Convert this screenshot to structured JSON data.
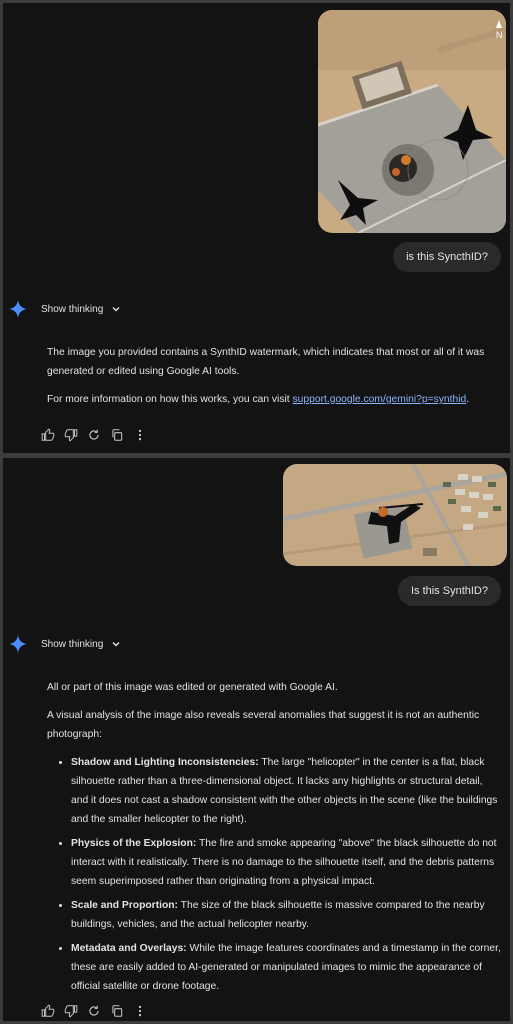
{
  "conversation1": {
    "user_message": "is this SyncthID?",
    "thinking_label": "Show thinking",
    "response": {
      "p1": "The image you provided contains a SynthID watermark, which indicates that most or all of it was generated or edited using Google AI tools.",
      "p2_prefix": "For more information on how this works, you can visit ",
      "link": "support.google.com/gemini?p=synthid",
      "p2_suffix": "."
    },
    "image_compass": "N"
  },
  "conversation2": {
    "user_message": "Is this SynthID?",
    "thinking_label": "Show thinking",
    "response": {
      "p1": "All or part of this image was edited or generated with Google AI.",
      "p2": "A visual analysis of the image also reveals several anomalies that suggest it is not an authentic photograph:",
      "bullets": [
        {
          "title": "Shadow and Lighting Inconsistencies:",
          "text": " The large \"helicopter\" in the center is a flat, black silhouette rather than a three-dimensional object. It lacks any highlights or structural detail, and it does not cast a shadow consistent with the other objects in the scene (like the buildings and the smaller helicopter to the right)."
        },
        {
          "title": "Physics of the Explosion:",
          "text": " The fire and smoke appearing \"above\" the black silhouette do not interact with it realistically. There is no damage to the silhouette itself, and the debris patterns seem superimposed rather than originating from a physical impact."
        },
        {
          "title": "Scale and Proportion:",
          "text": " The size of the black silhouette is massive compared to the nearby buildings, vehicles, and the actual helicopter nearby."
        },
        {
          "title": "Metadata and Overlays:",
          "text": " While the image features coordinates and a timestamp in the corner, these are easily added to AI-generated or manipulated images to mimic the appearance of official satellite or drone footage."
        }
      ]
    }
  },
  "actions": [
    "thumbs-up-icon",
    "thumbs-down-icon",
    "regenerate-icon",
    "copy-icon",
    "more-vert-icon"
  ],
  "colors": {
    "background": "#131314",
    "bubble": "#282a2c",
    "link": "#8ab4f8",
    "gemini_blue": "#4a8df8"
  }
}
